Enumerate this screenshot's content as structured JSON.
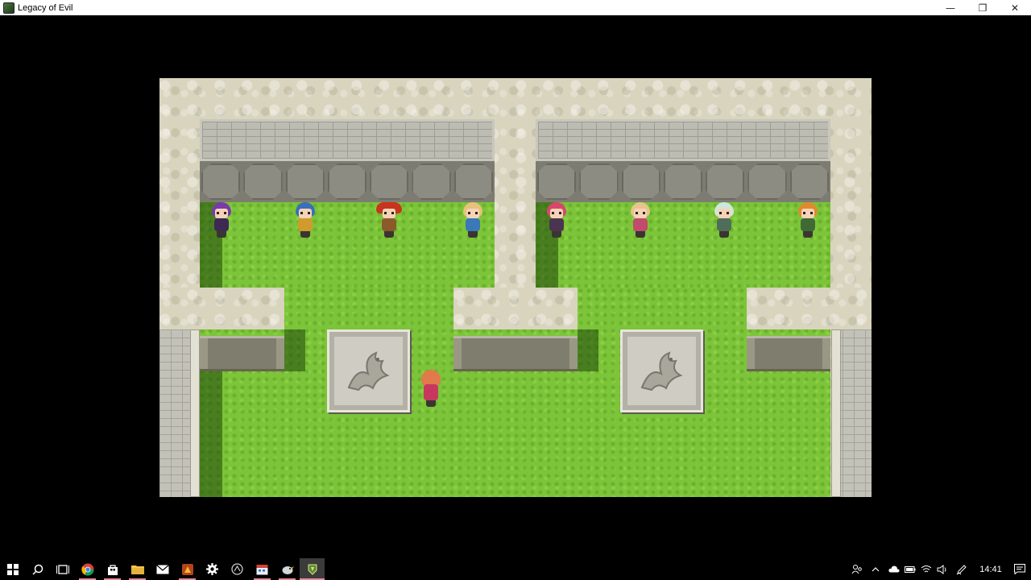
{
  "window": {
    "title": "Legacy of Evil",
    "minimize_glyph": "—",
    "maximize_glyph": "❐",
    "close_glyph": "✕"
  },
  "game": {
    "characters": [
      {
        "name": "purple-haired-character",
        "hair": "#7a3aa8",
        "body": "#3c2a55"
      },
      {
        "name": "blue-haired-character",
        "hair": "#3b6fb8",
        "body": "#d19a2c"
      },
      {
        "name": "red-hat-character",
        "hair": "#c8341e",
        "body": "#8a5a2a"
      },
      {
        "name": "blonde-character",
        "hair": "#e8c27a",
        "body": "#3a78b8"
      },
      {
        "name": "pink-haired-character",
        "hair": "#d8476a",
        "body": "#4a3450"
      },
      {
        "name": "light-blonde-character",
        "hair": "#e6c48a",
        "body": "#c24a6a"
      },
      {
        "name": "white-haired-character",
        "hair": "#cfe6da",
        "body": "#4f6e5a"
      },
      {
        "name": "orange-haired-character",
        "hair": "#e08a2e",
        "body": "#3f6a34"
      }
    ],
    "player": {
      "hair": "#e07a4a",
      "body": "#c8385e"
    }
  },
  "taskbar": {
    "apps": [
      {
        "name": "start-button",
        "icon": "windows-icon"
      },
      {
        "name": "search-button",
        "icon": "search-icon"
      },
      {
        "name": "task-view-button",
        "icon": "task-view-icon"
      },
      {
        "name": "chrome-app",
        "icon": "chrome-icon",
        "running": true
      },
      {
        "name": "store-app",
        "icon": "store-icon",
        "running": true
      },
      {
        "name": "file-explorer-app",
        "icon": "folder-icon",
        "running": true
      },
      {
        "name": "mail-app",
        "icon": "mail-icon"
      },
      {
        "name": "game-app-1",
        "icon": "game-icon",
        "running": true
      },
      {
        "name": "settings-app",
        "icon": "gear-icon"
      },
      {
        "name": "app-circle",
        "icon": "circle-icon"
      },
      {
        "name": "calendar-app",
        "icon": "calendar-icon",
        "running": true
      },
      {
        "name": "bird-app",
        "icon": "bird-icon",
        "running": true
      },
      {
        "name": "legacy-of-evil-app",
        "icon": "legacy-of-evil-icon",
        "active": true
      }
    ],
    "clock": "14:41"
  }
}
